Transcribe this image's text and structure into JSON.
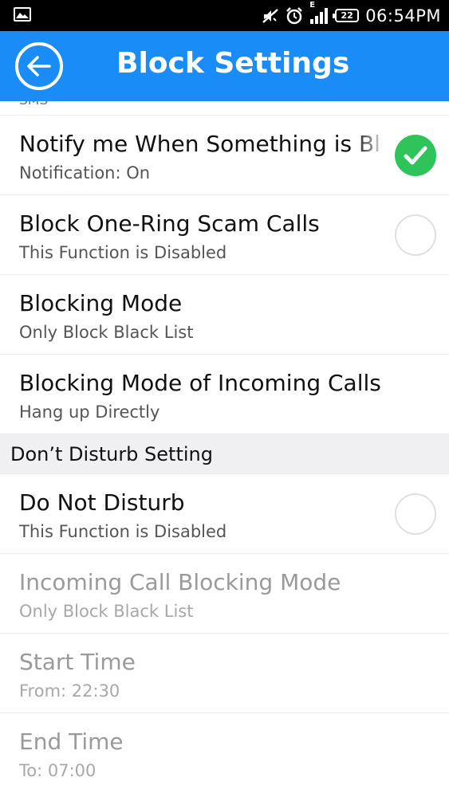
{
  "status_bar": {
    "time": "06:54PM",
    "battery": "22",
    "network": "E",
    "icons": [
      "gallery-icon",
      "mute-icon",
      "alarm-icon",
      "signal-icon",
      "battery-icon"
    ]
  },
  "header": {
    "title": "Block Settings",
    "background": "#1a8cf7",
    "back_icon": "back-arrow-icon"
  },
  "partial_row": {
    "label": "SMS"
  },
  "settings": [
    {
      "title": "Notify me When Something is Blocked",
      "subtitle": "Notification: On",
      "toggle": "on"
    },
    {
      "title": "Block One-Ring Scam Calls",
      "subtitle": "This Function is Disabled",
      "toggle": "off"
    },
    {
      "title": "Blocking Mode",
      "subtitle": "Only Block Black List"
    },
    {
      "title": "Blocking Mode of Incoming Calls",
      "subtitle": "Hang up Directly"
    }
  ],
  "dnd_section": {
    "header": "Don’t Disturb Setting",
    "items": [
      {
        "title": "Do Not Disturb",
        "subtitle": "This Function is Disabled",
        "toggle": "off"
      },
      {
        "title": "Incoming Call Blocking Mode",
        "subtitle": "Only Block Black List",
        "disabled": true
      },
      {
        "title": "Start Time",
        "subtitle": "From: 22:30",
        "disabled": true
      },
      {
        "title": "End Time",
        "subtitle": "To: 07:00",
        "disabled": true
      }
    ]
  },
  "colors": {
    "accent": "#1a8cf7",
    "toggle_on": "#2ec45a",
    "section_bg": "#f0f0f2"
  }
}
